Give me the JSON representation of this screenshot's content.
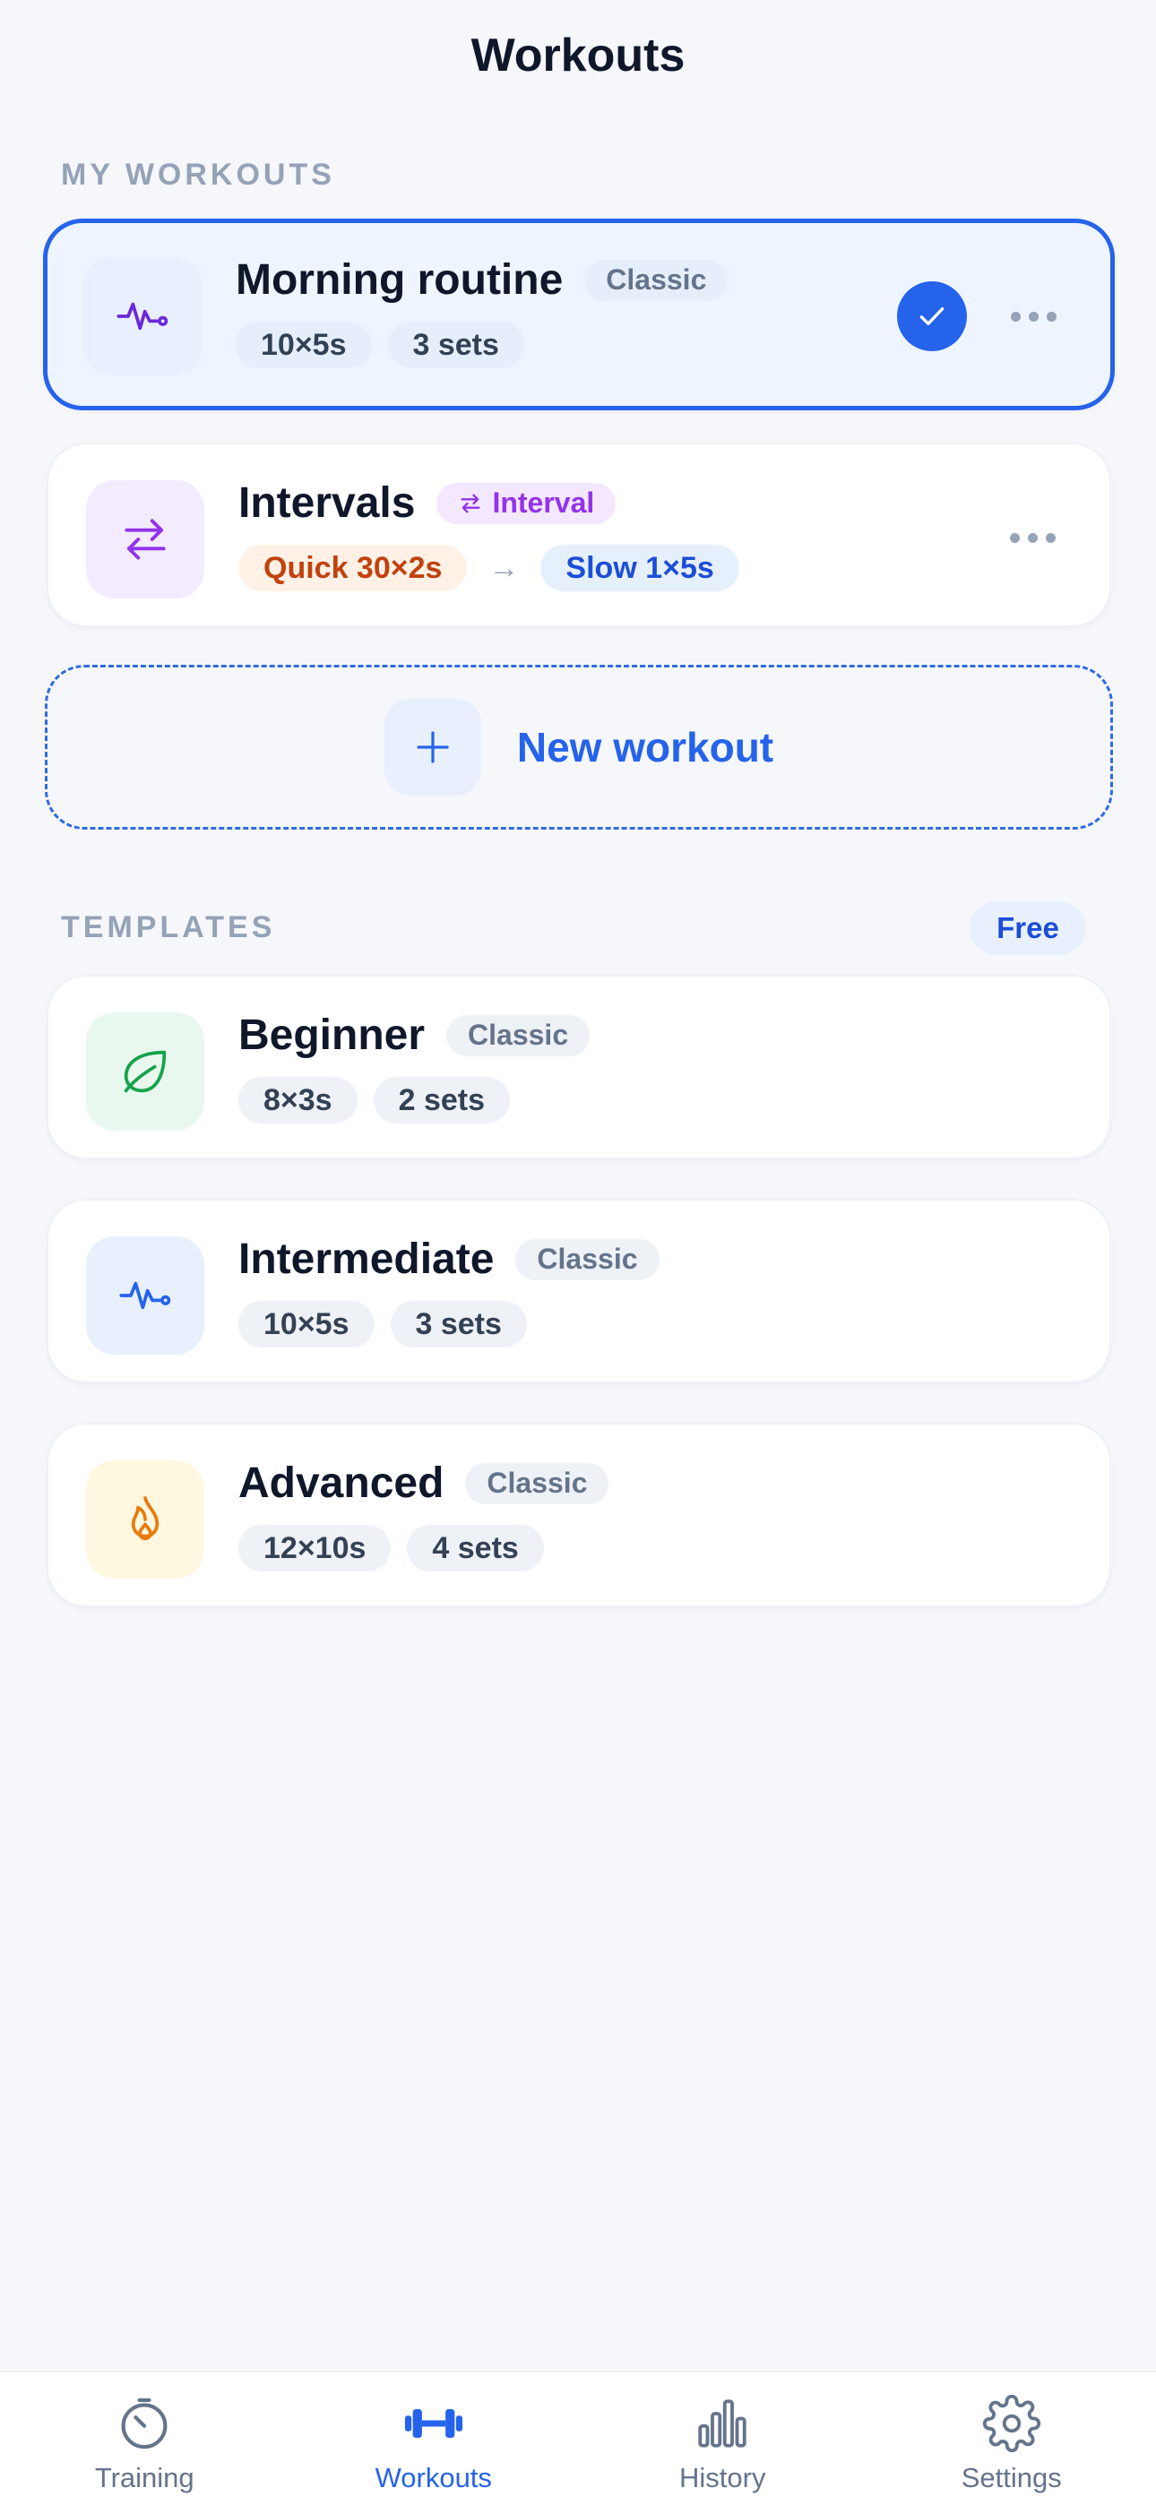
{
  "header": {
    "title": "Workouts"
  },
  "my_workouts": {
    "label": "MY WORKOUTS",
    "items": [
      {
        "title": "Morning routine",
        "type": "Classic",
        "chips": [
          "10×5s",
          "3 sets"
        ],
        "selected": true,
        "icon": "pulse-icon"
      },
      {
        "title": "Intervals",
        "type": "Interval",
        "chips": [
          "Quick 30×2s",
          "Slow 1×5s"
        ],
        "selected": false,
        "icon": "swap-arrows-icon"
      }
    ],
    "new_workout_label": "New workout"
  },
  "templates": {
    "label": "TEMPLATES",
    "badge": "Free",
    "items": [
      {
        "title": "Beginner",
        "type": "Classic",
        "chips": [
          "8×3s",
          "2 sets"
        ],
        "icon": "leaf-icon"
      },
      {
        "title": "Intermediate",
        "type": "Classic",
        "chips": [
          "10×5s",
          "3 sets"
        ],
        "icon": "pulse-icon"
      },
      {
        "title": "Advanced",
        "type": "Classic",
        "chips": [
          "12×10s",
          "4 sets"
        ],
        "icon": "flame-icon"
      }
    ]
  },
  "tab_bar": {
    "tabs": [
      {
        "label": "Training",
        "icon": "timer-icon"
      },
      {
        "label": "Workouts",
        "icon": "dumbbell-icon",
        "active": true
      },
      {
        "label": "History",
        "icon": "bar-chart-icon"
      },
      {
        "label": "Settings",
        "icon": "gear-icon"
      }
    ]
  },
  "colors": {
    "accent": "#2563eb",
    "background": "#f6f7fb",
    "quick": "#c2410c",
    "interval": "#9333ea"
  }
}
